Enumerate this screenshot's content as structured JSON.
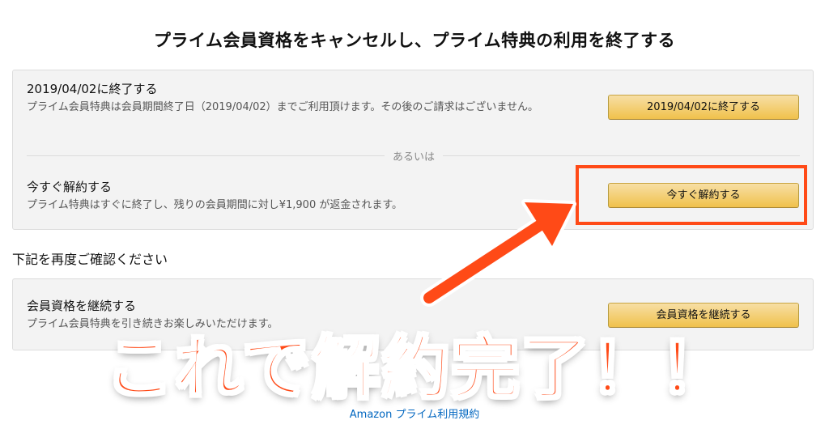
{
  "page": {
    "title": "プライム会員資格をキャンセルし、プライム特典の利用を終了する"
  },
  "option_end_on_date": {
    "title": "2019/04/02に終了する",
    "description": "プライム会員特典は会員期間終了日（2019/04/02）までご利用頂けます。その後のご請求はございません。",
    "button_label": "2019/04/02に終了する"
  },
  "divider": {
    "label": "あるいは"
  },
  "option_cancel_now": {
    "title": "今すぐ解約する",
    "description": "プライム特典はすぐに終了し、残りの会員期間に対し¥1,900 が返金されます。",
    "button_label": "今すぐ解約する"
  },
  "confirm_section": {
    "label": "下記を再度ご確認ください"
  },
  "option_continue": {
    "title": "会員資格を継続する",
    "description": "プライム会員特典を引き続きお楽しみいただけます。",
    "button_label": "会員資格を継続する"
  },
  "annotation": {
    "text": "これで解約完了！！",
    "color": "#ff4a17"
  },
  "footer": {
    "link_label": "Amazon プライム利用規約"
  },
  "colors": {
    "button_top": "#f7dfa5",
    "button_bottom": "#f0c14b",
    "card_bg": "#f3f3f3",
    "link": "#0066c0"
  }
}
